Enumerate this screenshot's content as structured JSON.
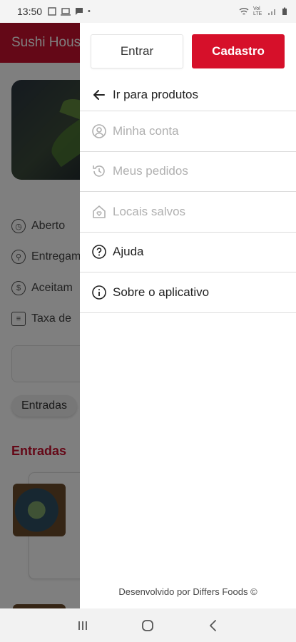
{
  "status_bar": {
    "time": "13:50",
    "signal_text": "Vol LTE"
  },
  "background_page": {
    "header_title": "Sushi House",
    "info": [
      "Aberto",
      "Entregam",
      "Aceitam",
      "Taxa de"
    ],
    "chip": "Entradas",
    "section_title": "Entradas"
  },
  "drawer": {
    "login_label": "Entrar",
    "signup_label": "Cadastro",
    "items": [
      {
        "label": "Ir para produtos",
        "icon": "arrow-left-icon",
        "enabled": true
      },
      {
        "label": "Minha conta",
        "icon": "account-icon",
        "enabled": false
      },
      {
        "label": "Meus pedidos",
        "icon": "history-icon",
        "enabled": false
      },
      {
        "label": "Locais salvos",
        "icon": "home-heart-icon",
        "enabled": false
      },
      {
        "label": "Ajuda",
        "icon": "help-circle-icon",
        "enabled": true
      },
      {
        "label": "Sobre o aplicativo",
        "icon": "info-circle-icon",
        "enabled": true
      }
    ],
    "footer": "Desenvolvido por Differs Foods ©"
  },
  "colors": {
    "brand": "#d6102a",
    "disabled": "#b0b0b0"
  }
}
